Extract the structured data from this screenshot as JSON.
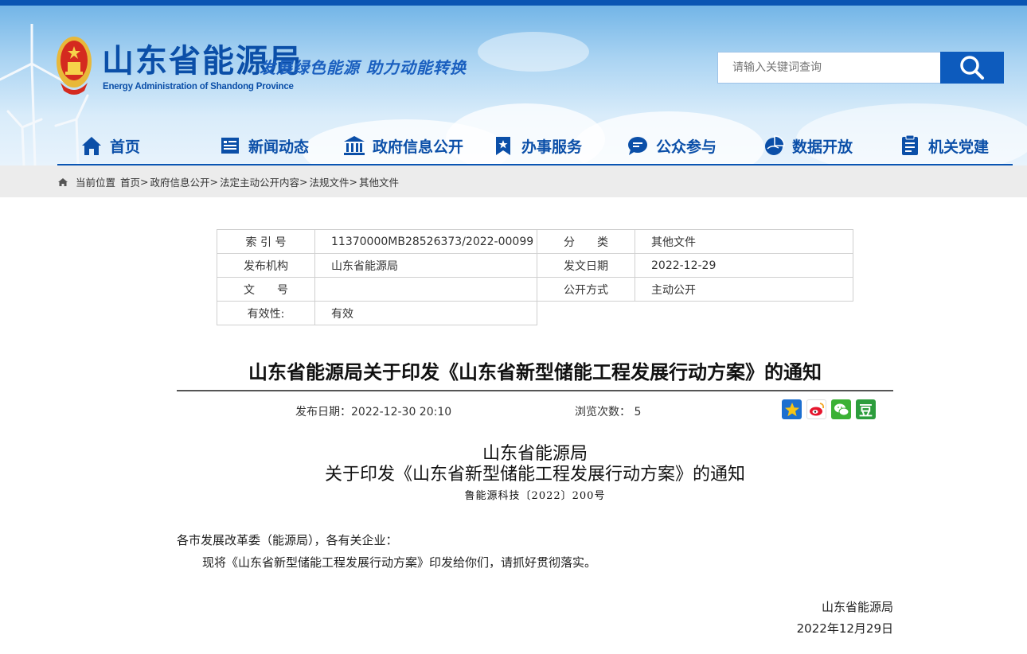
{
  "header": {
    "site_title": "山东省能源局",
    "site_subtitle": "Energy Administration of Shandong Province",
    "slogan": "发展绿色能源  助力动能转换",
    "search_placeholder": "请输入关键词查询"
  },
  "nav": {
    "items": [
      {
        "label": "首页",
        "icon": "home-icon"
      },
      {
        "label": "新闻动态",
        "icon": "news-icon"
      },
      {
        "label": "政府信息公开",
        "icon": "government-building-icon"
      },
      {
        "label": "办事服务",
        "icon": "bookmark-icon"
      },
      {
        "label": "公众参与",
        "icon": "chat-icon"
      },
      {
        "label": "数据开放",
        "icon": "pie-chart-icon"
      },
      {
        "label": "机关党建",
        "icon": "document-list-icon"
      }
    ]
  },
  "breadcrumb": {
    "prefix": "当前位置",
    "items": [
      "首页",
      "政府信息公开",
      "法定主动公开内容",
      "法规文件",
      "其他文件"
    ],
    "separator": ">"
  },
  "meta": {
    "index_label": "索 引 号",
    "index_value": "11370000MB28526373/2022-00099",
    "category_label": "分　　类",
    "category_value": "其他文件",
    "issuer_label": "发布机构",
    "issuer_value": "山东省能源局",
    "date_label": "发文日期",
    "date_value": "2022-12-29",
    "docno_label": "文　　号",
    "docno_value": "",
    "disclosure_label": "公开方式",
    "disclosure_value": "主动公开",
    "validity_label": "有效性:",
    "validity_value": "有效"
  },
  "article": {
    "title": "山东省能源局关于印发《山东省新型储能工程发展行动方案》的通知",
    "publish_label": "发布日期：",
    "publish_value": "2022-12-30 20:10",
    "views_label": "浏览次数：",
    "views_value": "5",
    "heading_line1": "山东省能源局",
    "heading_line2": "关于印发《山东省新型储能工程发展行动方案》的通知",
    "doc_number": "鲁能源科技〔2022〕200号",
    "salutation": "各市发展改革委（能源局），各有关企业：",
    "body": "现将《山东省新型储能工程发展行动方案》印发给你们，请抓好贯彻落实。",
    "signature": "山东省能源局",
    "sign_date": "2022年12月29日"
  },
  "share": {
    "icons": [
      "qzone-icon",
      "weibo-icon",
      "wechat-icon",
      "douban-icon"
    ],
    "douban_glyph": "豆"
  },
  "colors": {
    "brand_blue": "#0b4fa8",
    "nav_line": "#0a55b3",
    "search_button": "#0d5bbd",
    "breadcrumb_bg": "#ececec"
  }
}
